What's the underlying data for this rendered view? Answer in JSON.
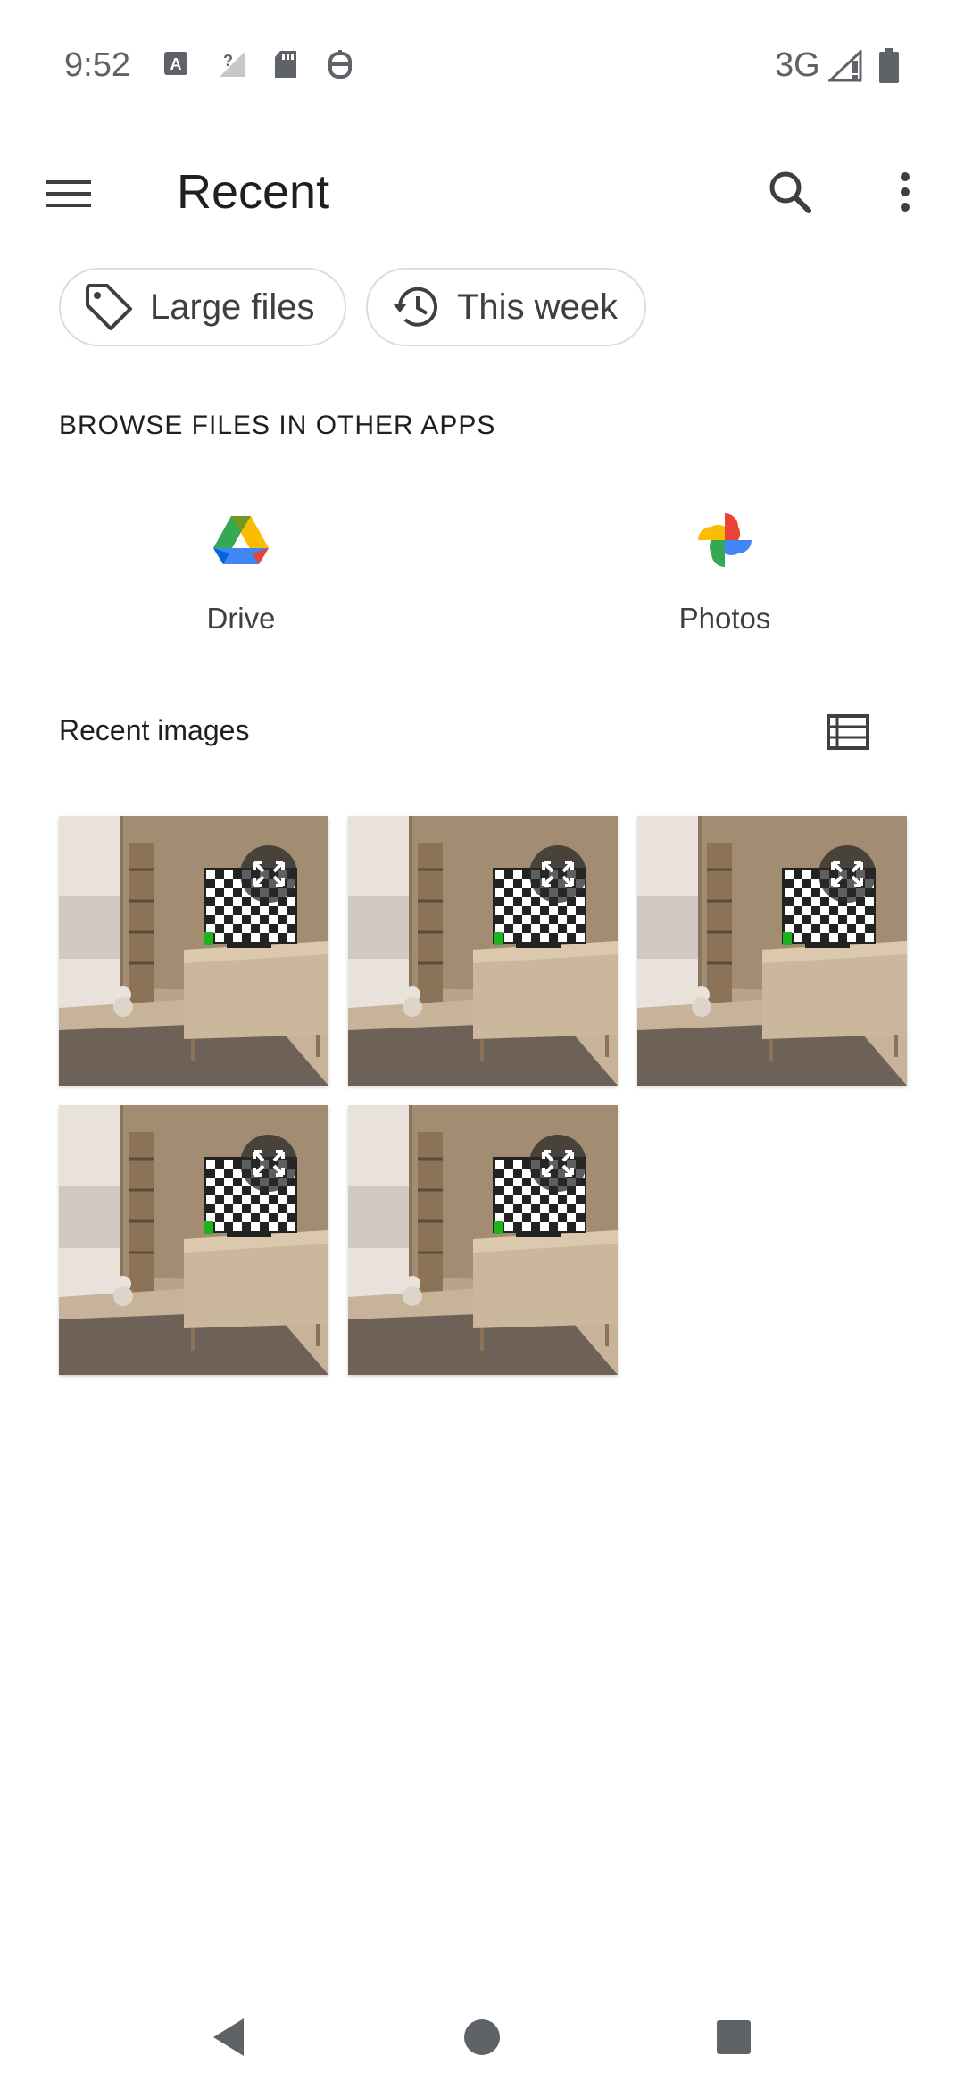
{
  "status_bar": {
    "time": "9:52",
    "network": "3G",
    "icons": [
      "font-a-icon",
      "no-signal-icon",
      "sd-card-icon",
      "assistant-icon",
      "signal-icon",
      "battery-icon"
    ]
  },
  "app_bar": {
    "title": "Recent",
    "menu_icon": "hamburger-menu-icon",
    "search_icon": "search-icon",
    "more_icon": "more-vert-icon"
  },
  "chips": [
    {
      "label": "Large files",
      "icon": "tag-icon"
    },
    {
      "label": "This week",
      "icon": "history-icon"
    }
  ],
  "browse": {
    "title": "BROWSE FILES IN OTHER APPS",
    "apps": [
      {
        "label": "Drive",
        "icon": "google-drive-icon"
      },
      {
        "label": "Photos",
        "icon": "google-photos-icon"
      }
    ]
  },
  "recent_images": {
    "title": "Recent images",
    "view_toggle_icon": "list-view-icon",
    "items": [
      {
        "name": "image-1",
        "overlay_icon": "fullscreen-icon"
      },
      {
        "name": "image-2",
        "overlay_icon": "fullscreen-icon"
      },
      {
        "name": "image-3",
        "overlay_icon": "fullscreen-icon"
      },
      {
        "name": "image-4",
        "overlay_icon": "fullscreen-icon"
      },
      {
        "name": "image-5",
        "overlay_icon": "fullscreen-icon"
      }
    ]
  },
  "nav_bar": {
    "back_icon": "back-icon",
    "home_icon": "home-icon",
    "recents_icon": "recents-icon"
  },
  "colors": {
    "text_primary": "#1f1f1f",
    "text_secondary": "#3c4043",
    "chip_border": "#dadce0",
    "status_grey": "#5f6368"
  }
}
